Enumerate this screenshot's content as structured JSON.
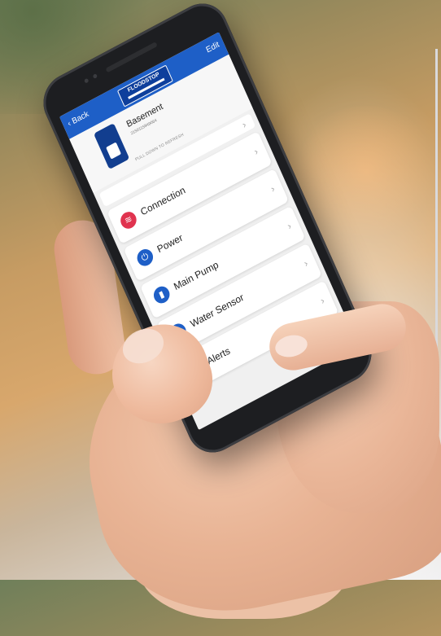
{
  "app": {
    "nav": {
      "back_label": "Back",
      "edit_label": "Edit",
      "logo_text": "FLOODSTOP"
    },
    "device": {
      "name": "Basement",
      "id": "2150115949064",
      "pull_hint": "PULL DOWN TO REFRESH"
    },
    "menu": [
      {
        "label": "Connection",
        "icon": "wifi-icon",
        "icon_color": "#e0334f"
      },
      {
        "label": "Power",
        "icon": "power-plug-icon",
        "icon_color": "#1e5fc7"
      },
      {
        "label": "Main Pump",
        "icon": "pump-icon",
        "icon_color": "#1e5fc7"
      },
      {
        "label": "Water Sensor",
        "icon": "water-drop-icon",
        "icon_color": "#1e5fc7"
      },
      {
        "label": "Alerts",
        "icon": "bell-icon",
        "icon_color": "#1e5fc7"
      }
    ],
    "chevron": "›"
  },
  "colors": {
    "brand_blue": "#1e5fc7",
    "accent_red": "#e0334f"
  }
}
